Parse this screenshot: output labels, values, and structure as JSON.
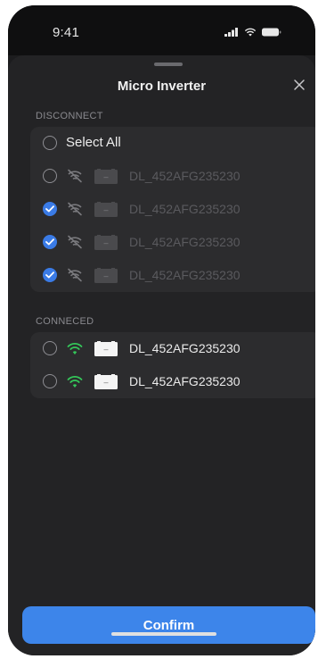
{
  "status_bar": {
    "time": "9:41"
  },
  "sheet": {
    "title": "Micro Inverter",
    "close_icon": "close-icon"
  },
  "disconnect_section": {
    "label": "DISCONNECT",
    "select_all_label": "Select All",
    "select_all_checked": false,
    "devices": [
      {
        "name": "DL_452AFG235230",
        "checked": false,
        "wifi": "wifi-off-icon"
      },
      {
        "name": "DL_452AFG235230",
        "checked": true,
        "wifi": "wifi-off-icon"
      },
      {
        "name": "DL_452AFG235230",
        "checked": true,
        "wifi": "wifi-off-icon"
      },
      {
        "name": "DL_452AFG235230",
        "checked": true,
        "wifi": "wifi-off-icon"
      }
    ]
  },
  "connected_section": {
    "label": "CONNECED",
    "devices": [
      {
        "name": "DL_452AFG235230",
        "checked": false,
        "wifi": "wifi-on-icon"
      },
      {
        "name": "DL_452AFG235230",
        "checked": false,
        "wifi": "wifi-on-icon"
      }
    ]
  },
  "confirm_label": "Confirm",
  "colors": {
    "accent": "#3d85ea",
    "check_blue": "#3a7be6",
    "wifi_green": "#34c759",
    "sheet_bg": "#232325",
    "card_bg": "#2c2c2e"
  }
}
